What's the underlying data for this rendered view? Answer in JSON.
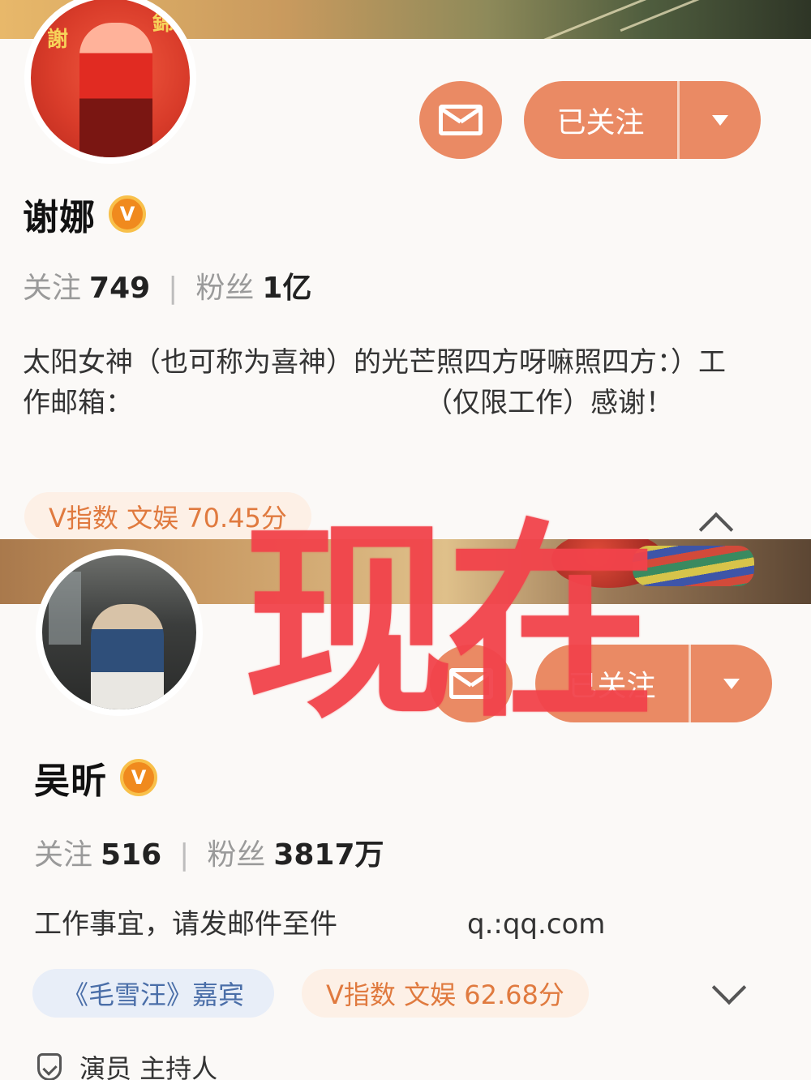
{
  "profiles": [
    {
      "name": "谢娜",
      "verified_badge": "V",
      "follow_button_label": "已关注",
      "following_label": "关注",
      "following_count": "749",
      "stat_separator": "|",
      "fans_label": "粉丝",
      "fans_count": "1亿",
      "bio_part1": "太阳女神（也可称为喜神）的光芒照四方呀嘛照四方：）工作邮箱：",
      "bio_part2": "（仅限工作）感谢！",
      "v_index": "V指数 文娱 70.45分",
      "avatar_text_1": "謝",
      "avatar_text_2": "錦"
    },
    {
      "name": "吴昕",
      "verified_badge": "V",
      "follow_button_label": "已关注",
      "following_label": "关注",
      "following_count": "516",
      "stat_separator": "|",
      "fans_label": "粉丝",
      "fans_count": "3817万",
      "bio_part1": "工作事宜，请发邮件至件",
      "bio_part2": "q.:qq.com",
      "guest_tag": "《毛雪汪》嘉宾",
      "v_index": "V指数 文娱 62.68分",
      "roles": "演员 主持人"
    }
  ],
  "overlay_text": "现在",
  "colors": {
    "accent": "#ea8a64",
    "overlay": "#f2434b",
    "badge": "#f08a1e",
    "pill_orange_text": "#e07a3f",
    "pill_blue_text": "#4a6ea8"
  },
  "icons": [
    "envelope-icon",
    "caret-down-icon",
    "chevron-up-icon",
    "chevron-down-icon",
    "shield-check-icon",
    "verified-v-icon"
  ]
}
